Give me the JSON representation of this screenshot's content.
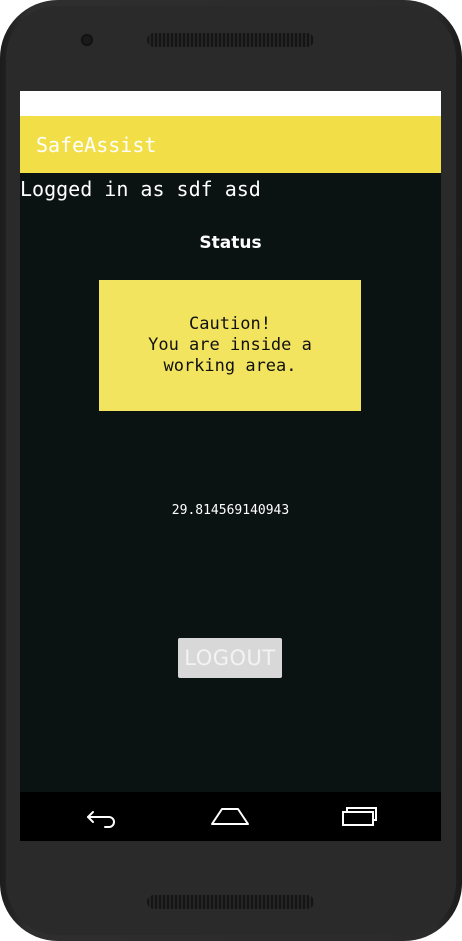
{
  "app": {
    "title": "SafeAssist"
  },
  "session": {
    "logged_in_text": "Logged in as sdf asd"
  },
  "status": {
    "heading": "Status",
    "caution_lines": [
      "Caution!",
      "You are inside a",
      "working area."
    ],
    "value": "29.814569140943",
    "box_color": "#f2e45e"
  },
  "actions": {
    "logout_label": "LOGOUT"
  },
  "navigation": {
    "buttons": [
      "back-icon",
      "home-icon",
      "recents-icon"
    ]
  },
  "colors": {
    "accent": "#f2df47",
    "background": "#0b1212"
  }
}
